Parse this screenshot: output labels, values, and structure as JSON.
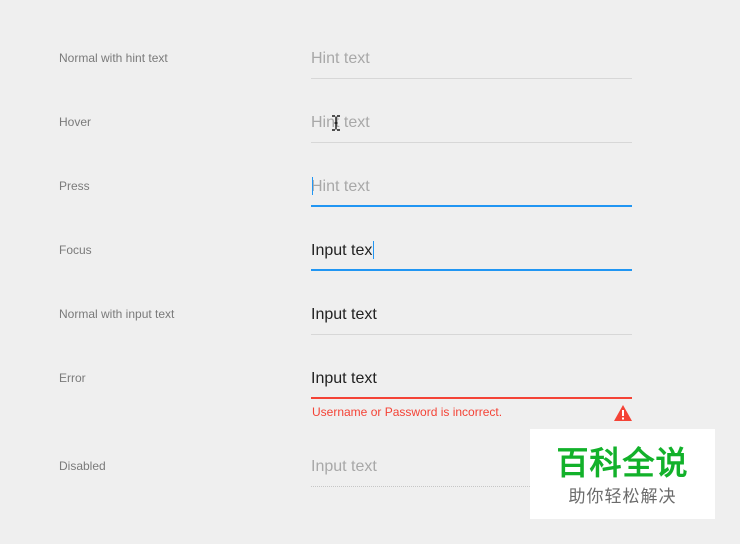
{
  "states": [
    {
      "label": "Normal with hint text",
      "value": "Hint text"
    },
    {
      "label": "Hover",
      "value": "Hint text"
    },
    {
      "label": "Press",
      "value": "Hint text"
    },
    {
      "label": "Focus",
      "value": "Input tex"
    },
    {
      "label": "Normal with input text",
      "value": "Input text"
    },
    {
      "label": "Error",
      "value": "Input text",
      "error_message": "Username or Password is incorrect."
    },
    {
      "label": "Disabled",
      "value": "Input text"
    }
  ],
  "colors": {
    "accent": "#2196f3",
    "error": "#f44336",
    "hint": "#a8a8a8",
    "text": "#222222"
  },
  "icons": {
    "hover_cursor": "text-cursor-icon",
    "error": "warning-icon"
  },
  "watermark": {
    "line1": "百科全说",
    "line2": "助你轻松解决"
  }
}
